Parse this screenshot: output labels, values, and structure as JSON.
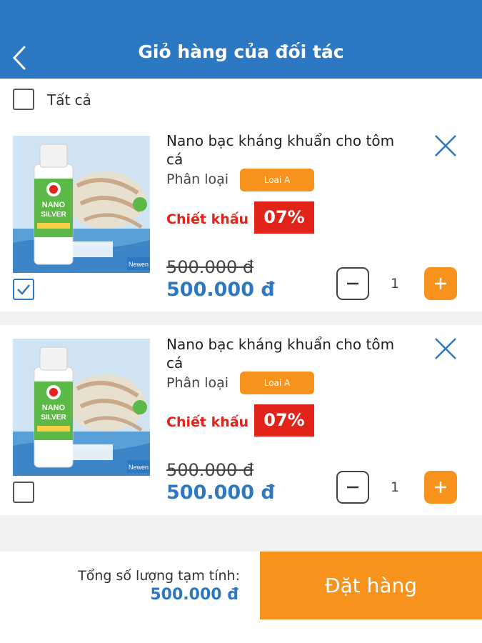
{
  "header": {
    "title": "Giỏ hàng của đối tác",
    "back_icon": "chevron-left-icon",
    "background": "#2d78c2"
  },
  "select_all": {
    "label": "Tất cả",
    "checked": false
  },
  "items": [
    {
      "name": "Nano bạc kháng khuẩn cho tôm cá",
      "variant_label": "Phân loại",
      "variant_value": "Loai A",
      "discount_label": "Chiết khấu",
      "discount_value": "07%",
      "price_old": "500.000 đ",
      "price_new": "500.000 đ",
      "quantity": "1",
      "checked": true,
      "image_text": {
        "brand_top": "NANO",
        "brand_bottom": "SILVER",
        "corner": "Newen"
      }
    },
    {
      "name": "Nano bạc kháng khuẩn cho tôm cá",
      "variant_label": "Phân loại",
      "variant_value": "Loai A",
      "discount_label": "Chiết khấu",
      "discount_value": "07%",
      "price_old": "500.000 đ",
      "price_new": "500.000 đ",
      "quantity": "1",
      "checked": false,
      "image_text": {
        "brand_top": "NANO",
        "brand_bottom": "SILVER",
        "corner": "Newen"
      }
    }
  ],
  "footer": {
    "total_label": "Tổng số lượng tạm tính:",
    "total_value": "500.000 đ",
    "order_button": "Đặt hàng"
  },
  "colors": {
    "primary": "#2d78c2",
    "accent": "#f7931d",
    "discount": "#e2231a"
  }
}
